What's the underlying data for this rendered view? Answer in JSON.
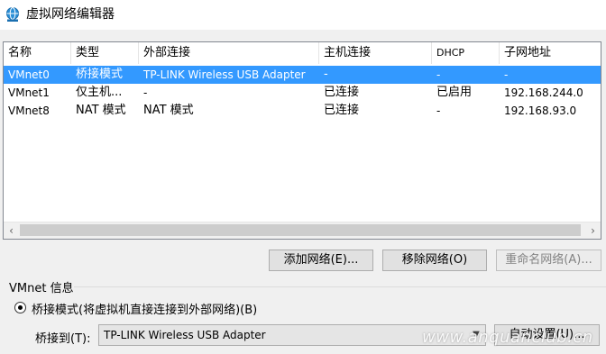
{
  "window": {
    "title": "虚拟网络编辑器",
    "icon": "network-globe-icon"
  },
  "table": {
    "columns": [
      "名称",
      "类型",
      "外部连接",
      "主机连接",
      "DHCP",
      "子网地址"
    ],
    "rows": [
      {
        "name": "VMnet0",
        "type": "桥接模式",
        "external": "TP-LINK Wireless USB Adapter",
        "host": "-",
        "dhcp": "-",
        "subnet": "-"
      },
      {
        "name": "VMnet1",
        "type": "仅主机...",
        "external": "-",
        "host": "已连接",
        "dhcp": "已启用",
        "subnet": "192.168.244.0"
      },
      {
        "name": "VMnet8",
        "type": "NAT 模式",
        "external": "NAT 模式",
        "host": "已连接",
        "dhcp": "-",
        "subnet": "192.168.93.0"
      }
    ],
    "selected_row": 0
  },
  "buttons": {
    "add": "添加网络(E)...",
    "remove": "移除网络(O)",
    "rename": "重命名网络(A)..."
  },
  "vmnet_info": {
    "group_label": "VMnet 信息",
    "bridge_mode_label": "桥接模式(将虚拟机直接连接到外部网络)(B)",
    "bridge_to_label": "桥接到(T):",
    "bridge_to_value": "TP-LINK Wireless USB Adapter",
    "auto_settings_label": "自动设置(U)..."
  },
  "watermark": "www.anquanclub.cn",
  "colors": {
    "selection": "#3399ff",
    "window_bg": "#f0f0f0"
  }
}
